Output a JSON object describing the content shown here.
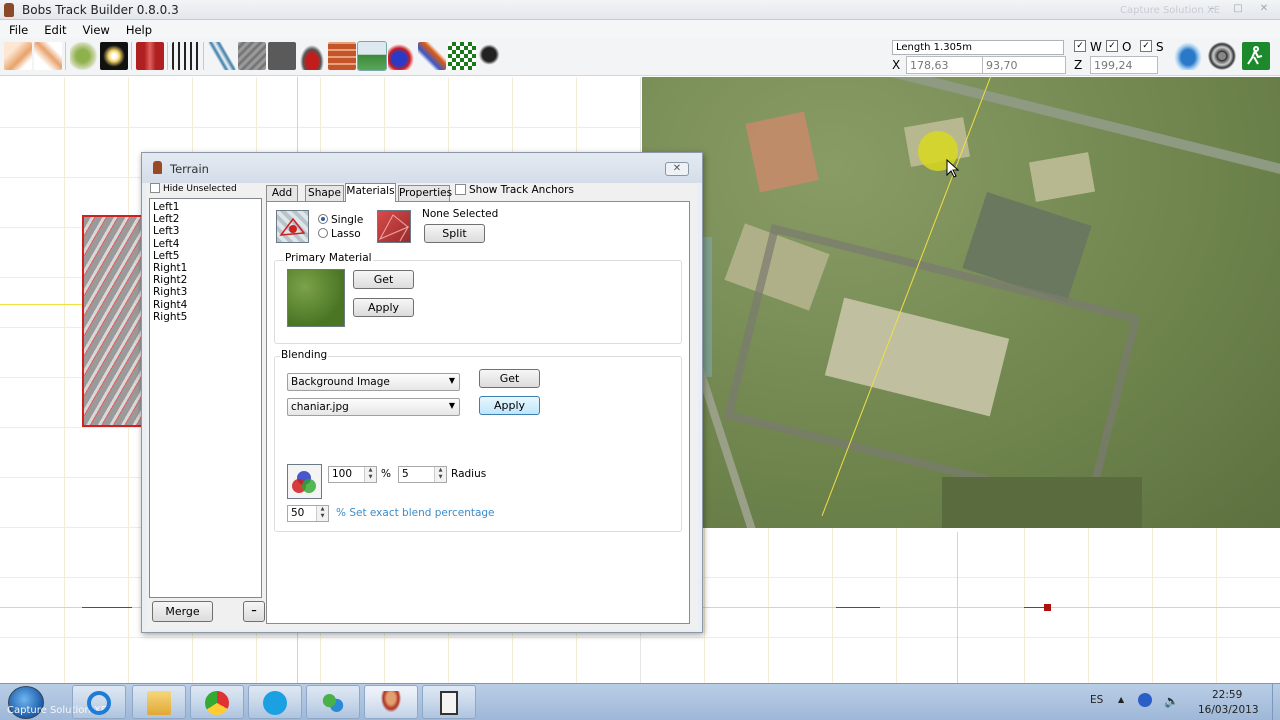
{
  "window": {
    "title": "Bobs Track Builder 0.8.0.3",
    "watermark": "Capture Solution XE",
    "controls": {
      "minimize": "–",
      "maximize": "□",
      "close": "✕"
    }
  },
  "menu": [
    "File",
    "Edit",
    "View",
    "Help"
  ],
  "toolbar": {
    "icons": [
      "spline-tool-icon",
      "spline-edit-icon",
      "world-map-icon",
      "sun-icon",
      "wall-icon",
      "crossing-icon",
      "road-curve-icon",
      "texture-icon",
      "dark-texture-icon",
      "car-icon",
      "brick-icon",
      "terrain-icon",
      "objects-icon",
      "paint-icon",
      "checker-icon",
      "camera-icon"
    ],
    "length": "Length 1.305m",
    "x_label": "X",
    "x_value": "178,63",
    "y_label": "Y",
    "y_value": "93,70",
    "z_label": "Z",
    "z_value": "199,24",
    "w_label": "W",
    "o_label": "O",
    "s_label": "S",
    "check_mark": "✓",
    "right_icons": [
      "helicopter-icon",
      "steering-wheel-icon",
      "exit-icon"
    ]
  },
  "terrain_dialog": {
    "title": "Terrain",
    "close_glyph": "✕",
    "hide_unselected": "Hide Unselected",
    "sections": [
      "Left1",
      "Left2",
      "Left3",
      "Left4",
      "Left5",
      "Right1",
      "Right2",
      "Right3",
      "Right4",
      "Right5"
    ],
    "merge": "Merge",
    "collapse_glyph": "━",
    "tabs": [
      "Add",
      "Shape",
      "Materials",
      "Properties"
    ],
    "active_tab": "Materials",
    "show_track_anchors": "Show Track Anchors",
    "single": "Single",
    "lasso": "Lasso",
    "none_selected": "None Selected",
    "split": "Split",
    "primary_material_label": "Primary Material",
    "get": "Get",
    "apply": "Apply",
    "blending_label": "Blending",
    "blend_source": "Background Image",
    "blend_image": "chaniar.jpg",
    "blend_get": "Get",
    "blend_apply": "Apply",
    "opacity_value": "100",
    "percent": "%",
    "radius_value": "5",
    "radius_label": "Radius",
    "exact_value": "50",
    "exact_label": "% Set exact blend percentage",
    "combo_arrow": "▼",
    "spin_up": "▲",
    "spin_down": "▼"
  },
  "taskbar": {
    "apps": [
      "ie-icon",
      "folder-icon",
      "chrome-icon",
      "skype-icon",
      "people-icon",
      "btb-icon",
      "doc-icon"
    ],
    "watermark": "Capture Solution XE",
    "lang": "ES",
    "time": "22:59",
    "date": "16/03/2013"
  }
}
